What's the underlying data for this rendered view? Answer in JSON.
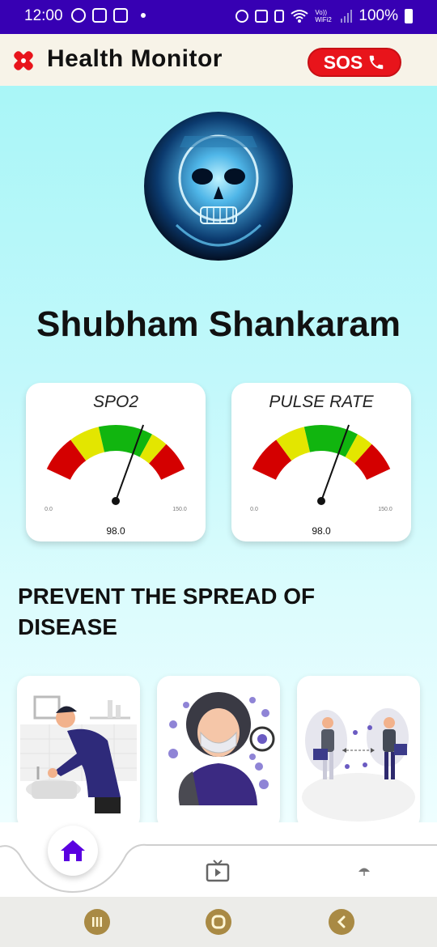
{
  "status_bar": {
    "time": "12:00",
    "battery": "100%",
    "left_icons": [
      "whatsapp-icon",
      "voicemail-icon",
      "gallery-icon"
    ],
    "right_icons": [
      "alarm-icon",
      "mute-icon",
      "lock-icon",
      "wifi-icon",
      "signal-icon",
      "battery-icon"
    ],
    "wifi_label": "Vo)) WiFi2"
  },
  "header": {
    "title": "Health Monitor",
    "sos_label": "SOS",
    "logo_icon": "health-cross-icon",
    "accent_color": "#e8141b"
  },
  "profile": {
    "name": "Shubham Shankaram",
    "avatar_icon": "skull-avatar"
  },
  "gauges": [
    {
      "title": "SPO2",
      "value": "98.0",
      "min_label": "0.0",
      "max_label": "150.0",
      "value_num": 98,
      "min": 0,
      "max": 150
    },
    {
      "title": "PULSE RATE",
      "value": "98.0",
      "min_label": "0.0",
      "max_label": "150.0",
      "value_num": 98,
      "min": 0,
      "max": 150
    }
  ],
  "gauge_colors": {
    "red": "#d40000",
    "yellow": "#e3e600",
    "green": "#11b50f"
  },
  "section": {
    "title": "PREVENT THE SPREAD OF DISEASE"
  },
  "cards": [
    {
      "icon": "wash-hands-illustration"
    },
    {
      "icon": "wear-mask-illustration"
    },
    {
      "icon": "social-distance-illustration"
    }
  ],
  "bottom_nav": {
    "items": [
      "home-icon",
      "tv-play-icon",
      "umbrella-icon"
    ],
    "active": "home-icon",
    "active_color": "#5a00e0"
  },
  "system_nav": [
    "recents-icon",
    "home-circle-icon",
    "back-icon"
  ]
}
